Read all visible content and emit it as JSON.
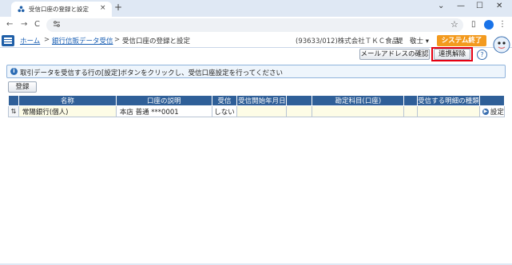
{
  "browser": {
    "tab_title": "受信口座の登録と設定",
    "new_tab": "+",
    "tab_close": "×",
    "window_controls": [
      "⌄",
      "—",
      "☐",
      "✕"
    ],
    "nav": [
      "←",
      "→",
      "C"
    ],
    "address_icon": "site-settings-icon"
  },
  "header": {
    "breadcrumb": [
      {
        "label": "ホーム",
        "link": true
      },
      {
        "label": "銀行信販データ受信",
        "link": true
      },
      {
        "label": "受信口座の登録と設定",
        "link": false
      }
    ],
    "separator": ">",
    "company": "(93633/012)株式会社ＴＫＣ食品",
    "user": "堤　敬士",
    "user_menu_icon": "▾",
    "system_exit": "システム終了"
  },
  "actions": {
    "mail_confirm": "メールアドレスの確認",
    "unlink": "連携解除",
    "help": "?"
  },
  "info_message": "取引データを受信する行の[設定]ボタンをクリックし、受信口座設定を行ってください",
  "register_button": "登録",
  "table": {
    "headers": [
      "",
      "名称",
      "口座の説明",
      "受信",
      "受信開始年月日",
      "",
      "勘定科目(口座)",
      "",
      "受信する明細の種類",
      ""
    ],
    "rows": [
      {
        "handle": "⇅",
        "name": "常陽銀行(個人)",
        "description": "本店 普通 ***0001",
        "receive": "しない",
        "start_date": "",
        "account": "",
        "detail_type": "",
        "action": "設定"
      }
    ]
  },
  "colors": {
    "header_bg": "#2f5f98",
    "accent_orange": "#f39a1e",
    "highlight_red": "#e60012",
    "link_blue": "#1a5fb4"
  }
}
